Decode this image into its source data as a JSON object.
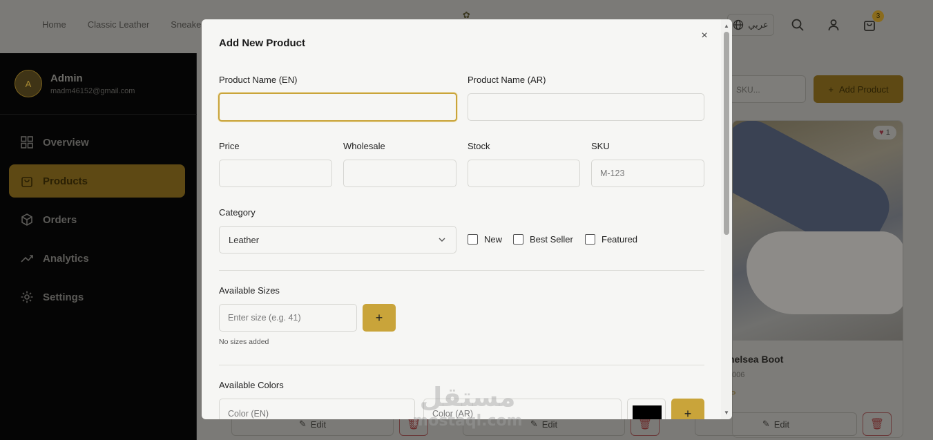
{
  "header": {
    "nav": [
      "Home",
      "Classic Leather",
      "Sneake"
    ],
    "lang_label": "عربي",
    "cart_count": "3"
  },
  "sidebar": {
    "avatar_initial": "A",
    "admin_name": "Admin",
    "admin_email": "madm46152@gmail.com",
    "items": [
      {
        "label": "Overview",
        "icon": "grid-icon"
      },
      {
        "label": "Products",
        "icon": "bag-icon",
        "active": true
      },
      {
        "label": "Orders",
        "icon": "box-icon"
      },
      {
        "label": "Analytics",
        "icon": "trend-icon"
      },
      {
        "label": "Settings",
        "icon": "gear-icon"
      }
    ]
  },
  "main": {
    "search_placeholder": "SKU...",
    "add_product_label": "Add Product",
    "card": {
      "likes": "1",
      "title": "helsea Boot",
      "sku": "006",
      "price": "P"
    },
    "edit_label": "Edit"
  },
  "modal": {
    "title": "Add New Product",
    "close_symbol": "×",
    "product_name_en_label": "Product Name (EN)",
    "product_name_ar_label": "Product Name (AR)",
    "price_label": "Price",
    "wholesale_label": "Wholesale",
    "stock_label": "Stock",
    "sku_label": "SKU",
    "sku_placeholder": "M-123",
    "category_label": "Category",
    "category_value": "Leather",
    "checkboxes": [
      "New",
      "Best Seller",
      "Featured"
    ],
    "sizes_label": "Available Sizes",
    "size_placeholder": "Enter size (e.g. 41)",
    "add_symbol": "+",
    "no_sizes_text": "No sizes added",
    "colors_label": "Available Colors",
    "color_en_placeholder": "Color (EN)",
    "color_ar_placeholder": "Color (AR)",
    "color_swatch_value": "#000000"
  },
  "watermark": {
    "arabic": "مستقل",
    "latin": "mostaql.com"
  }
}
